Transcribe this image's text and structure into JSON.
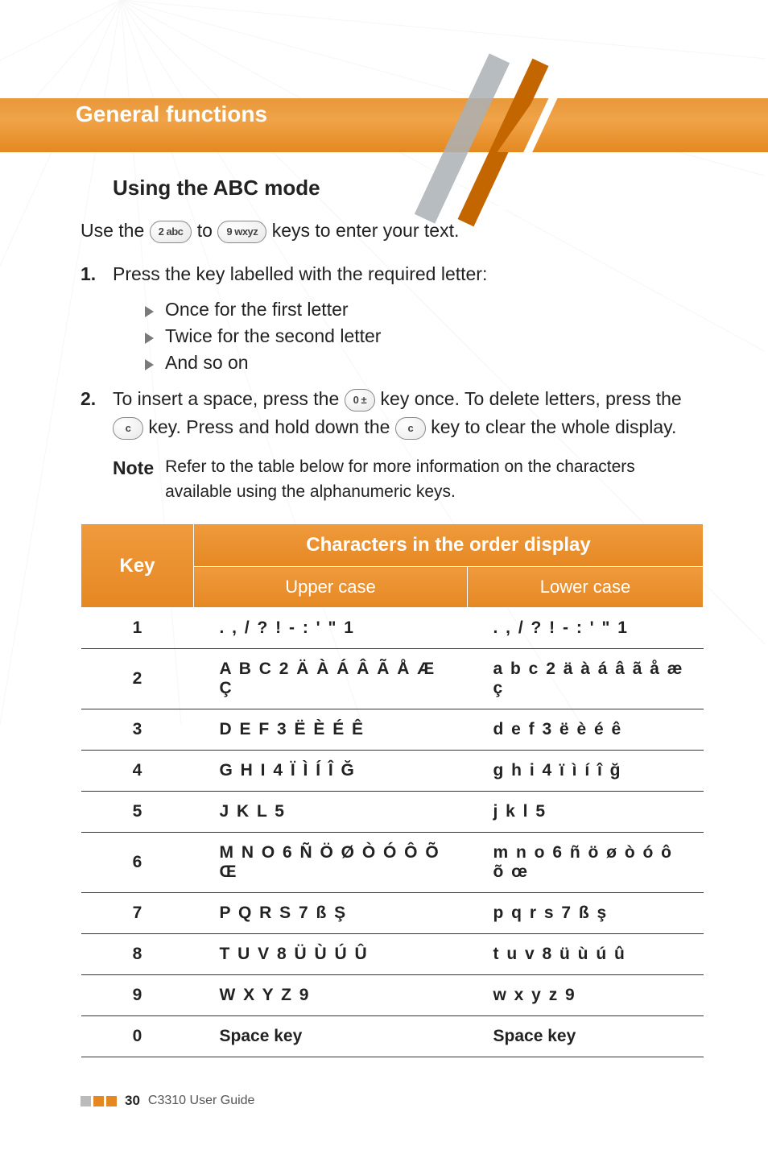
{
  "header": {
    "section_title": "General functions"
  },
  "section": {
    "heading": "Using the ABC mode",
    "use_line_a": "Use the ",
    "key2": "2 abc",
    "use_line_b": " to ",
    "key9": "9 wxyz",
    "use_line_c": " keys to enter your text.",
    "step1_num": "1.",
    "step1": "Press the key labelled with the required letter:",
    "bullet1": "Once for the first letter",
    "bullet2": "Twice for the second letter",
    "bullet3": "And so on",
    "step2_num": "2.",
    "step2a": "To insert a space, press the ",
    "key0": "0 ±",
    "step2b": " key once. To delete letters, press the ",
    "keyC1": "c",
    "step2c": " key. Press and hold down the ",
    "keyC2": "c",
    "step2d": " key to clear the whole display.",
    "note_label": "Note",
    "note_text": "Refer to the table below for more information on the characters available using the alphanumeric keys."
  },
  "table": {
    "col_key": "Key",
    "col_span": "Characters in the order display",
    "col_upper": "Upper case",
    "col_lower": "Lower case",
    "rows": [
      {
        "k": "1",
        "u": ". , / ? ! - : ' \" 1",
        "l": ". , / ? ! - : ' \" 1"
      },
      {
        "k": "2",
        "u": "A B C 2 Ä À Á Â Ã Å Æ Ç",
        "l": "a b c 2 ä à á â ã å æ ç"
      },
      {
        "k": "3",
        "u": "D E F 3 Ë È É Ê",
        "l": "d e f 3 ë è é ê"
      },
      {
        "k": "4",
        "u": "G H I 4 Ï Ì Í Î Ğ",
        "l": "g h i 4 ï ì í î ğ"
      },
      {
        "k": "5",
        "u": "J K L 5",
        "l": "j k l 5"
      },
      {
        "k": "6",
        "u": "M N O 6 Ñ Ö Ø Ò Ó Ô Õ Œ",
        "l": "m n o 6 ñ ö ø ò ó ô õ œ"
      },
      {
        "k": "7",
        "u": "P Q R S 7 ß Ş",
        "l": "p q r s 7 ß ş"
      },
      {
        "k": "8",
        "u": "T U V 8 Ü Ù Ú Û",
        "l": "t u v 8 ü ù ú û"
      },
      {
        "k": "9",
        "u": "W X Y Z 9",
        "l": "w x y z 9"
      },
      {
        "k": "0",
        "u": "Space key",
        "l": "Space key"
      }
    ]
  },
  "footer": {
    "page_no": "30",
    "guide": "C3310 User Guide"
  }
}
